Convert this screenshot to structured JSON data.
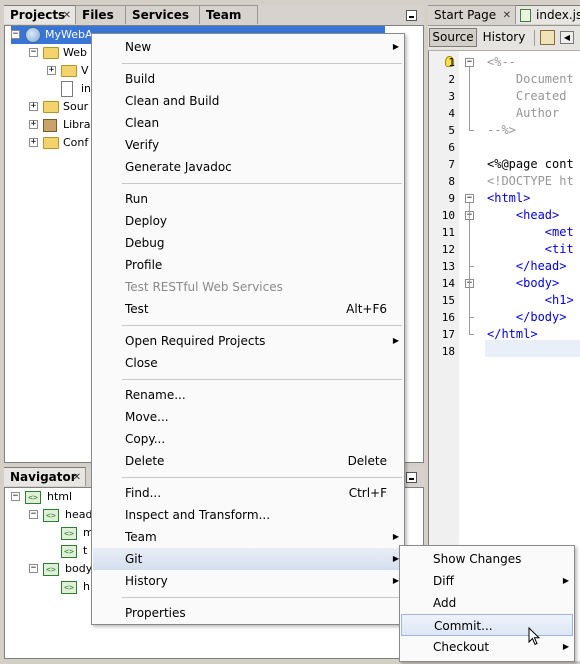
{
  "left_tabs": {
    "projects": "Projects",
    "files": "Files",
    "services": "Services",
    "team": "Team"
  },
  "project_tree": [
    {
      "label": "MyWebA",
      "icon": "globe-icon",
      "expander": "−"
    },
    {
      "label": "Web",
      "icon": "folder-icon",
      "expander": "−"
    },
    {
      "label": "V",
      "icon": "folder-icon",
      "expander": "+"
    },
    {
      "label": "in",
      "icon": "jsp-file-icon",
      "expander": ""
    },
    {
      "label": "Sour",
      "icon": "source-package-icon",
      "expander": "+"
    },
    {
      "label": "Libra",
      "icon": "library-icon",
      "expander": "+"
    },
    {
      "label": "Conf",
      "icon": "config-folder-icon",
      "expander": "+"
    }
  ],
  "navigator": {
    "title": "Navigator",
    "items": [
      {
        "label": "html",
        "expander": "−"
      },
      {
        "label": "head",
        "expander": "−"
      },
      {
        "label": "m",
        "expander": ""
      },
      {
        "label": "t",
        "expander": ""
      },
      {
        "label": "body",
        "expander": "−"
      },
      {
        "label": "h",
        "expander": ""
      }
    ]
  },
  "editor": {
    "tabs": {
      "start_page": "Start Page",
      "index": "index.jsp"
    },
    "toolbar": {
      "source": "Source",
      "history": "History"
    },
    "line_numbers": [
      "1",
      "2",
      "3",
      "4",
      "5",
      "6",
      "7",
      "8",
      "9",
      "10",
      "11",
      "12",
      "13",
      "14",
      "15",
      "16",
      "17",
      "18"
    ],
    "lines": [
      {
        "text": "<%--",
        "color": "#969696"
      },
      {
        "text": "    Document",
        "color": "#969696"
      },
      {
        "text": "    Created",
        "color": "#969696"
      },
      {
        "text": "    Author",
        "color": "#969696"
      },
      {
        "text": "--%>",
        "color": "#969696"
      },
      {
        "text": "",
        "color": "#000000"
      },
      {
        "text": "<%@page cont",
        "color": "#000000"
      },
      {
        "text": "<!DOCTYPE ht",
        "color": "#969696"
      },
      {
        "text": "<html>",
        "color": "#0000e6"
      },
      {
        "text": "    <head>",
        "color": "#0000e6"
      },
      {
        "text": "        <met",
        "color": "#0000e6"
      },
      {
        "text": "        <tit",
        "color": "#0000e6"
      },
      {
        "text": "    </head>",
        "color": "#0000e6"
      },
      {
        "text": "    <body>",
        "color": "#0000e6"
      },
      {
        "text": "        <h1>",
        "color": "#0000e6"
      },
      {
        "text": "    </body>",
        "color": "#0000e6"
      },
      {
        "text": "</html>",
        "color": "#0000e6"
      },
      {
        "text": "",
        "color": "#000000"
      }
    ]
  },
  "context_menu": [
    {
      "label": "New",
      "submenu": true
    },
    {
      "sep": true
    },
    {
      "label": "Build"
    },
    {
      "label": "Clean and Build"
    },
    {
      "label": "Clean"
    },
    {
      "label": "Verify"
    },
    {
      "label": "Generate Javadoc"
    },
    {
      "sep": true
    },
    {
      "label": "Run"
    },
    {
      "label": "Deploy"
    },
    {
      "label": "Debug"
    },
    {
      "label": "Profile"
    },
    {
      "label": "Test RESTful Web Services",
      "disabled": true
    },
    {
      "label": "Test",
      "accel": "Alt+F6"
    },
    {
      "sep": true
    },
    {
      "label": "Open Required Projects",
      "submenu": true
    },
    {
      "label": "Close"
    },
    {
      "sep": true
    },
    {
      "label": "Rename..."
    },
    {
      "label": "Move..."
    },
    {
      "label": "Copy..."
    },
    {
      "label": "Delete",
      "accel": "Delete"
    },
    {
      "sep": true
    },
    {
      "label": "Find...",
      "accel": "Ctrl+F"
    },
    {
      "label": "Inspect and Transform..."
    },
    {
      "label": "Team",
      "submenu": true
    },
    {
      "label": "Git",
      "submenu": true,
      "highlight": true
    },
    {
      "label": "History",
      "submenu": true
    },
    {
      "sep": true
    },
    {
      "label": "Properties"
    }
  ],
  "git_submenu": [
    {
      "label": "Show Changes"
    },
    {
      "label": "Diff",
      "submenu": true
    },
    {
      "label": "Add"
    },
    {
      "label": "Commit...",
      "hover": true
    },
    {
      "label": "Checkout",
      "submenu": true
    }
  ],
  "colors": {
    "menu_highlight": "#d4dfee",
    "comment": "#969696",
    "tag": "#0000e6"
  }
}
